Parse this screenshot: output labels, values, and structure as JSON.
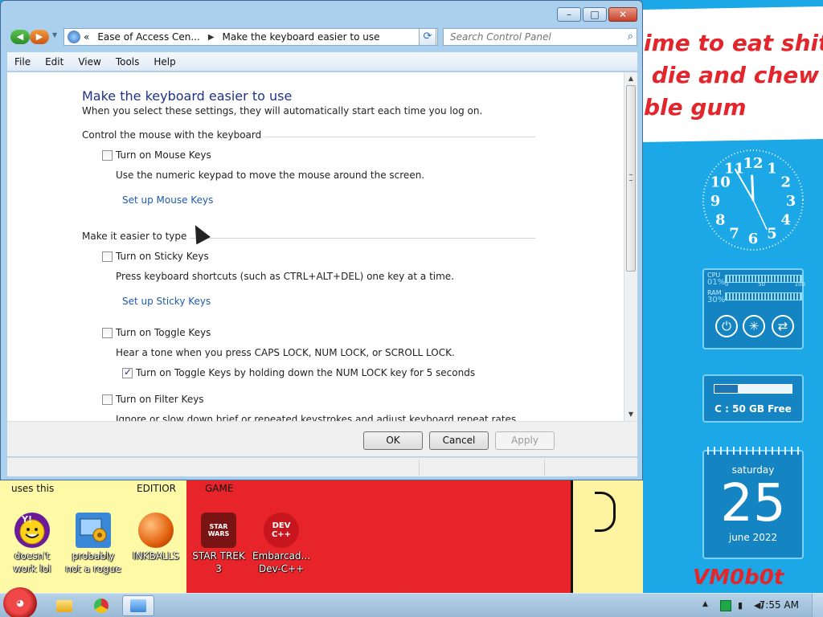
{
  "window": {
    "breadcrumb": {
      "prefix": "«",
      "segment1": "Ease of Access Cen...",
      "separator": "▶",
      "segment2": "Make the keyboard easier to use"
    },
    "search_placeholder": "Search Control Panel",
    "menu": [
      "File",
      "Edit",
      "View",
      "Tools",
      "Help"
    ],
    "buttons": {
      "minimize": "–",
      "maximize": "□",
      "close": "✕"
    }
  },
  "content": {
    "title": "Make the keyboard easier to use",
    "subtitle": "When you select these settings, they will automatically start each time you log on.",
    "section_mouse": "Control the mouse with the keyboard",
    "mouse_keys": {
      "label": "Turn on Mouse Keys",
      "checked": false,
      "description": "Use the numeric keypad to move the mouse around the screen.",
      "link": "Set up Mouse Keys"
    },
    "section_type": "Make it easier to type",
    "sticky_keys": {
      "label": "Turn on Sticky Keys",
      "checked": false,
      "description": "Press keyboard shortcuts (such as CTRL+ALT+DEL) one key at a time.",
      "link": "Set up Sticky Keys"
    },
    "toggle_keys": {
      "label": "Turn on Toggle Keys",
      "checked": false,
      "description": "Hear a tone when you press CAPS LOCK, NUM LOCK, or SCROLL LOCK.",
      "sub_label": "Turn on Toggle Keys by holding down the NUM LOCK key for 5 seconds",
      "sub_checked": true
    },
    "filter_keys": {
      "label": "Turn on Filter Keys",
      "checked": false,
      "description": "Ignore or slow down brief or repeated keystrokes and adjust keyboard repeat rates."
    }
  },
  "dialog_buttons": {
    "ok": "OK",
    "cancel": "Cancel",
    "apply": "Apply"
  },
  "wallpaper": {
    "text": "ime to eat shit\n die and chew\nble gum",
    "labels": {
      "uses_this": "uses this",
      "editior": "EDITIOR",
      "game": "GAME"
    },
    "signature": "VM0b0t"
  },
  "desktop_icons": [
    {
      "label": "doesn't work lol",
      "icon": "yahoo-messenger-icon"
    },
    {
      "label": "probably not a rogue",
      "icon": "control-panel-icon"
    },
    {
      "label": "INKBALLS",
      "icon": "inkball-icon"
    },
    {
      "label": "STAR TREK 3",
      "icon": "star-wars-game-icon",
      "badge": "STAR WARS"
    },
    {
      "label": "Embarcad... Dev-C++",
      "icon": "dev-cpp-icon",
      "badge": "DEV C++"
    }
  ],
  "gadgets": {
    "meter": {
      "cpu_label": "CPU",
      "cpu_value": "01%",
      "ram_label": "RAM",
      "ram_value": "30%",
      "scale": [
        "0",
        "50",
        "100"
      ],
      "cpu_fraction": 0.01,
      "ram_fraction": 0.3
    },
    "drive": {
      "text": "C : 50 GB Free",
      "used_fraction": 0.3
    },
    "calendar": {
      "day": "saturday",
      "date": "25",
      "month": "june 2022"
    },
    "clock": {
      "numbers": [
        "12",
        "1",
        "2",
        "3",
        "4",
        "5",
        "6",
        "7",
        "8",
        "9",
        "10",
        "11"
      ],
      "hour": 11,
      "minute": 55
    }
  },
  "taskbar": {
    "time": "7:55 AM"
  },
  "colors": {
    "desktop_blue": "#1ca8e6",
    "wall_red": "#e3262b",
    "link_blue": "#1e5aa8",
    "title_blue": "#1e3287"
  }
}
